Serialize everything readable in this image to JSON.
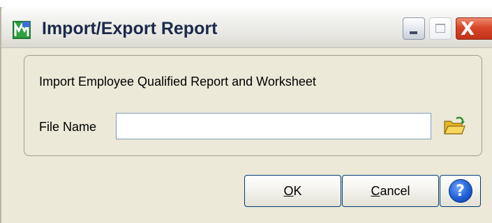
{
  "window": {
    "title": "Import/Export Report",
    "app_icon": "sage-mas-icon",
    "controls": {
      "minimize_icon": "minimize-icon",
      "maximize_icon": "maximize-icon",
      "close_glyph": "X"
    }
  },
  "group": {
    "heading": "Import  Employee Qualified Report and Worksheet"
  },
  "file": {
    "label": "File Name",
    "value": "",
    "placeholder": "",
    "browse_icon": "open-folder-icon"
  },
  "buttons": {
    "ok_mnemonic": "O",
    "ok_rest": "K",
    "cancel_mnemonic": "C",
    "cancel_rest": "ancel",
    "help_glyph": "?"
  },
  "colors": {
    "dialog_background": "#ece9d8",
    "button_border": "#003c74",
    "help_blue": "#1f5fd6",
    "close_red": "#d9462a"
  }
}
